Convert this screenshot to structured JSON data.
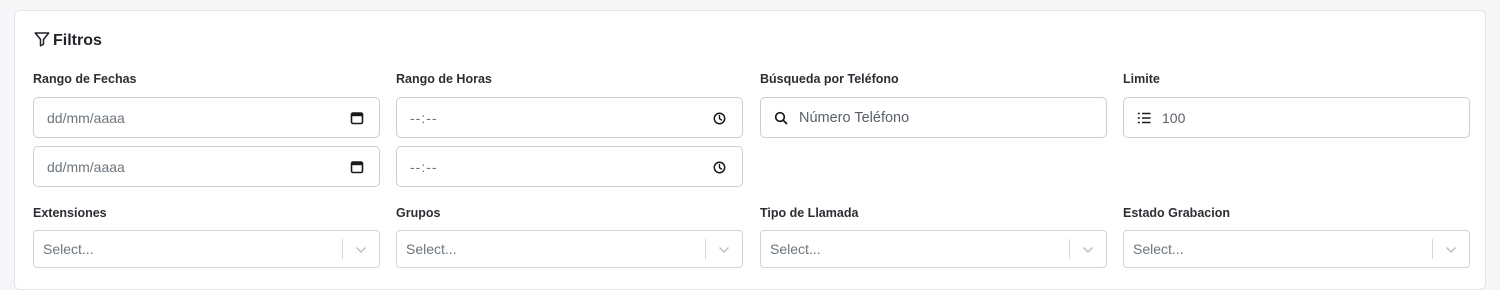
{
  "panel": {
    "title": "Filtros",
    "icon": "filter-icon"
  },
  "date_range": {
    "label": "Rango de Fechas",
    "start_placeholder": "dd/mm/aaaa",
    "end_placeholder": "dd/mm/aaaa",
    "icon": "calendar-icon"
  },
  "time_range": {
    "label": "Rango de Horas",
    "start_placeholder": "--:--",
    "end_placeholder": "--:--",
    "icon": "clock-icon"
  },
  "phone_search": {
    "label": "Búsqueda por Teléfono",
    "placeholder": "Número Teléfono",
    "icon": "search-icon"
  },
  "limit": {
    "label": "Limite",
    "value": "100",
    "icon": "list-ordered-icon"
  },
  "selects": [
    {
      "label": "Extensiones",
      "placeholder": "Select..."
    },
    {
      "label": "Grupos",
      "placeholder": "Select..."
    },
    {
      "label": "Tipo de Llamada",
      "placeholder": "Select..."
    },
    {
      "label": "Estado Grabacion",
      "placeholder": "Select..."
    }
  ],
  "colors": {
    "border": "#c9ced6",
    "label": "#2b2f33",
    "placeholder": "#6c757d",
    "card_bg": "#ffffff"
  }
}
